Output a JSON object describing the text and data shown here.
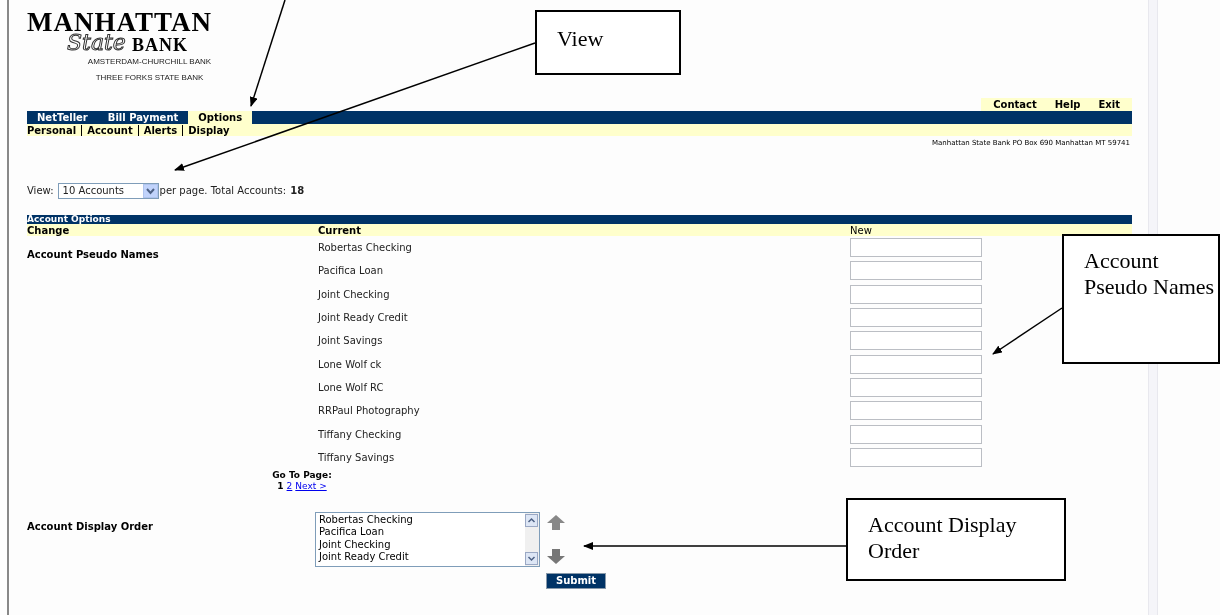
{
  "logo": {
    "name_top": "MANHATTAN",
    "script": "State",
    "name_bottom": "BANK",
    "affiliates": [
      "AMSTERDAM-CHURCHILL BANK",
      "THREE FORKS STATE BANK"
    ]
  },
  "top_links": [
    "Contact",
    "Help",
    "Exit"
  ],
  "nav_tabs": [
    {
      "label": "NetTeller",
      "selected": false
    },
    {
      "label": "Bill Payment",
      "selected": false
    },
    {
      "label": "Options",
      "selected": true
    }
  ],
  "sub_nav": [
    "Personal",
    "Account",
    "Alerts",
    "Display"
  ],
  "address": "Manhattan State Bank PO Box 690 Manhattan MT 59741",
  "view": {
    "label": "View:",
    "value": "10 Accounts",
    "suffix": "per page. Total Accounts:",
    "total": "18"
  },
  "account_options": {
    "title": "Account Options",
    "columns": [
      "Change",
      "Current",
      "New"
    ],
    "pseudo_names": {
      "label": "Account Pseudo Names",
      "accounts": [
        "Robertas Checking",
        "Pacifica Loan",
        "Joint Checking",
        "Joint Ready Credit",
        "Joint Savings",
        "Lone Wolf ck",
        "Lone Wolf RC",
        "RRPaul Photography",
        "Tiffany Checking",
        "Tiffany Savings"
      ]
    },
    "pagination": {
      "label": "Go To Page:",
      "pages": [
        {
          "label": "1",
          "selected": true
        },
        {
          "label": "2",
          "selected": false
        }
      ],
      "next": "Next >"
    },
    "display_order": {
      "label": "Account Display Order",
      "items": [
        "Robertas Checking",
        "Pacifica Loan",
        "Joint Checking",
        "Joint Ready Credit"
      ],
      "submit": "Submit"
    }
  },
  "annotations": [
    {
      "text": "View"
    },
    {
      "text": "Account Pseudo Names"
    },
    {
      "text": "Account Display Order"
    }
  ]
}
